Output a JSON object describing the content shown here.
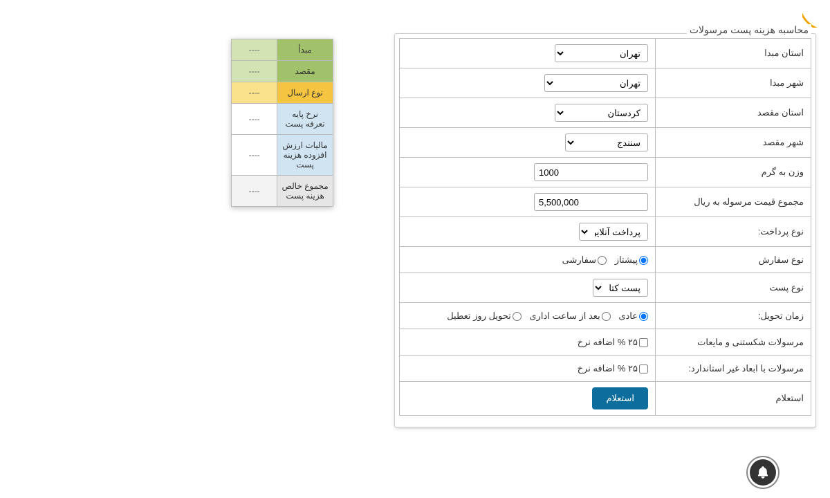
{
  "legend": "محاسبه هزینه پست مرسولات",
  "form": {
    "origin_province": {
      "label": "استان مبدا",
      "value": "تهران"
    },
    "origin_city": {
      "label": "شهر مبدا",
      "value": "تهران"
    },
    "dest_province": {
      "label": "استان مقصد",
      "value": "کردستان"
    },
    "dest_city": {
      "label": "شهر مقصد",
      "value": "سنندج"
    },
    "weight": {
      "label": "وزن به گرم",
      "value": "1000"
    },
    "total_price": {
      "label": "مجموع قیمت مرسوله به ریال",
      "value": "5,500,000"
    },
    "payment_type": {
      "label": "نوع پرداخت:",
      "value": "پرداخت آنلاین"
    },
    "order_type": {
      "label": "نوع سفارش",
      "opt1": "پیشتاز",
      "opt2": "سفارشی"
    },
    "post_type": {
      "label": "نوع پست",
      "value": "پست کتاب"
    },
    "delivery_time": {
      "label": "زمان تحویل:",
      "opt1": "عادی",
      "opt2": "بعد از ساعت اداری",
      "opt3": "تحویل روز تعطیل"
    },
    "fragile": {
      "label": "مرسولات شکستنی و مایعات",
      "cb": "۲۵ % اضافه نرخ"
    },
    "nonstandard": {
      "label": "مرسولات با ابعاد غیر استاندارد:",
      "cb": "۲۵ % اضافه نرخ"
    },
    "inquiry": {
      "label": "استعلام",
      "button": "استعلام"
    }
  },
  "result": {
    "r1": {
      "label": "مبدأ",
      "value": "----"
    },
    "r2": {
      "label": "مقصد",
      "value": "----"
    },
    "r3": {
      "label": "نوع ارسال",
      "value": "----"
    },
    "r4": {
      "label": "نرخ پایه تعرفه پست",
      "value": "----"
    },
    "r5": {
      "label": "مالیات ارزش افزوده هزینه پست",
      "value": "----"
    },
    "r6": {
      "label": "مجموع خالص هزینه پست",
      "value": "----"
    }
  }
}
